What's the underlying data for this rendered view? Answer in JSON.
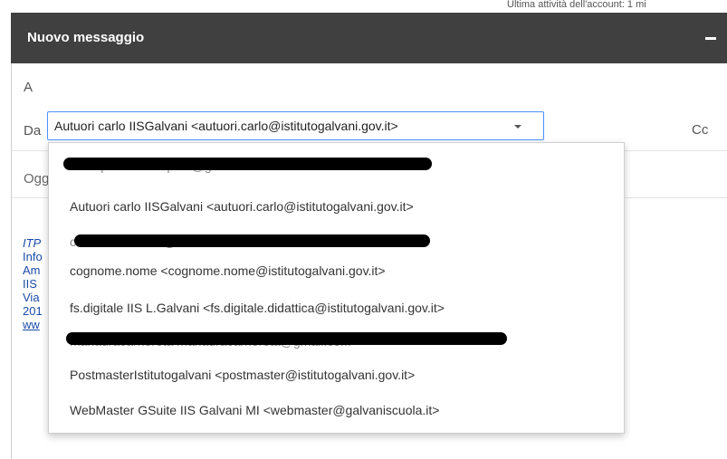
{
  "window": {
    "account_activity": "Ultima attività dell'account: 1 mi",
    "title": "Nuovo messaggio"
  },
  "compose": {
    "to_label": "A",
    "from_label": "Da",
    "from_selected": "Autuori carlo IISGalvani <autuori.carlo@istitutogalvani.gov.it>",
    "cc_label": "Cc",
    "subject_placeholder": "Oggetto"
  },
  "signature": {
    "lines": [
      "ITP",
      "Info",
      "Am",
      "IIS",
      "Via",
      "201",
      "ww"
    ]
  },
  "from_menu": {
    "items": [
      {
        "label": "carlo.p....... carlo.p.....@gmail.com",
        "redacted": true
      },
      {
        "label": "Autuori carlo IISGalvani <autuori.carlo@istitutogalvani.gov.it>",
        "redacted": false
      },
      {
        "label": "carlo.a........ ......i@.......it",
        "redacted": true
      },
      {
        "label": "cognome.nome <cognome.nome@istitutogalvani.gov.it>",
        "redacted": false
      },
      {
        "label": "fs.digitale IIS L.Galvani <fs.digitale.didattica@istitutogalvani.gov.it>",
        "redacted": false
      },
      {
        "label": "mariauracarnerota mariauracarnerota@gmail.com",
        "redacted": true
      },
      {
        "label": "PostmasterIstitutogalvani <postmaster@istitutogalvani.gov.it>",
        "redacted": false
      },
      {
        "label": "WebMaster GSuite IIS Galvani MI <webmaster@galvaniscuola.it>",
        "redacted": false
      }
    ]
  },
  "icons": {
    "minimize": "minimize-icon",
    "caret": "chevron-down-icon"
  }
}
